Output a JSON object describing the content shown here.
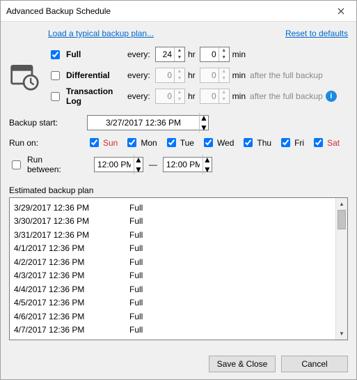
{
  "title": "Advanced Backup Schedule",
  "links": {
    "load": "Load a typical backup plan...",
    "reset": "Reset to defaults"
  },
  "types": {
    "full": {
      "label": "Full",
      "checked": true,
      "every": "every:",
      "hr": "24",
      "min": "0",
      "hr_unit": "hr",
      "min_unit": "min"
    },
    "diff": {
      "label": "Differential",
      "checked": false,
      "every": "every:",
      "hr": "0",
      "min": "0",
      "hr_unit": "hr",
      "min_unit": "min",
      "suffix": "after the full backup"
    },
    "tlog": {
      "label": "Transaction Log",
      "checked": false,
      "every": "every:",
      "hr": "0",
      "min": "0",
      "hr_unit": "hr",
      "min_unit": "min",
      "suffix": "after the full backup"
    }
  },
  "backup_start": {
    "label": "Backup start:",
    "value": "3/27/2017 12:36 PM"
  },
  "run_on": {
    "label": "Run on:",
    "days": [
      {
        "name": "Sun",
        "checked": true,
        "red": true
      },
      {
        "name": "Mon",
        "checked": true,
        "red": false
      },
      {
        "name": "Tue",
        "checked": true,
        "red": false
      },
      {
        "name": "Wed",
        "checked": true,
        "red": false
      },
      {
        "name": "Thu",
        "checked": true,
        "red": false
      },
      {
        "name": "Fri",
        "checked": true,
        "red": false
      },
      {
        "name": "Sat",
        "checked": true,
        "red": true
      }
    ]
  },
  "run_between": {
    "label": "Run between:",
    "checked": false,
    "from": "12:00 PM",
    "dash": "—",
    "to": "12:00 PM"
  },
  "estimated_label": "Estimated backup plan",
  "plan": [
    {
      "dt": "3/29/2017 12:36 PM",
      "type": "Full"
    },
    {
      "dt": "3/30/2017 12:36 PM",
      "type": "Full"
    },
    {
      "dt": "3/31/2017 12:36 PM",
      "type": "Full"
    },
    {
      "dt": "4/1/2017 12:36 PM",
      "type": "Full"
    },
    {
      "dt": "4/2/2017 12:36 PM",
      "type": "Full"
    },
    {
      "dt": "4/3/2017 12:36 PM",
      "type": "Full"
    },
    {
      "dt": "4/4/2017 12:36 PM",
      "type": "Full"
    },
    {
      "dt": "4/5/2017 12:36 PM",
      "type": "Full"
    },
    {
      "dt": "4/6/2017 12:36 PM",
      "type": "Full"
    },
    {
      "dt": "4/7/2017 12:36 PM",
      "type": "Full"
    }
  ],
  "buttons": {
    "save": "Save & Close",
    "cancel": "Cancel"
  }
}
